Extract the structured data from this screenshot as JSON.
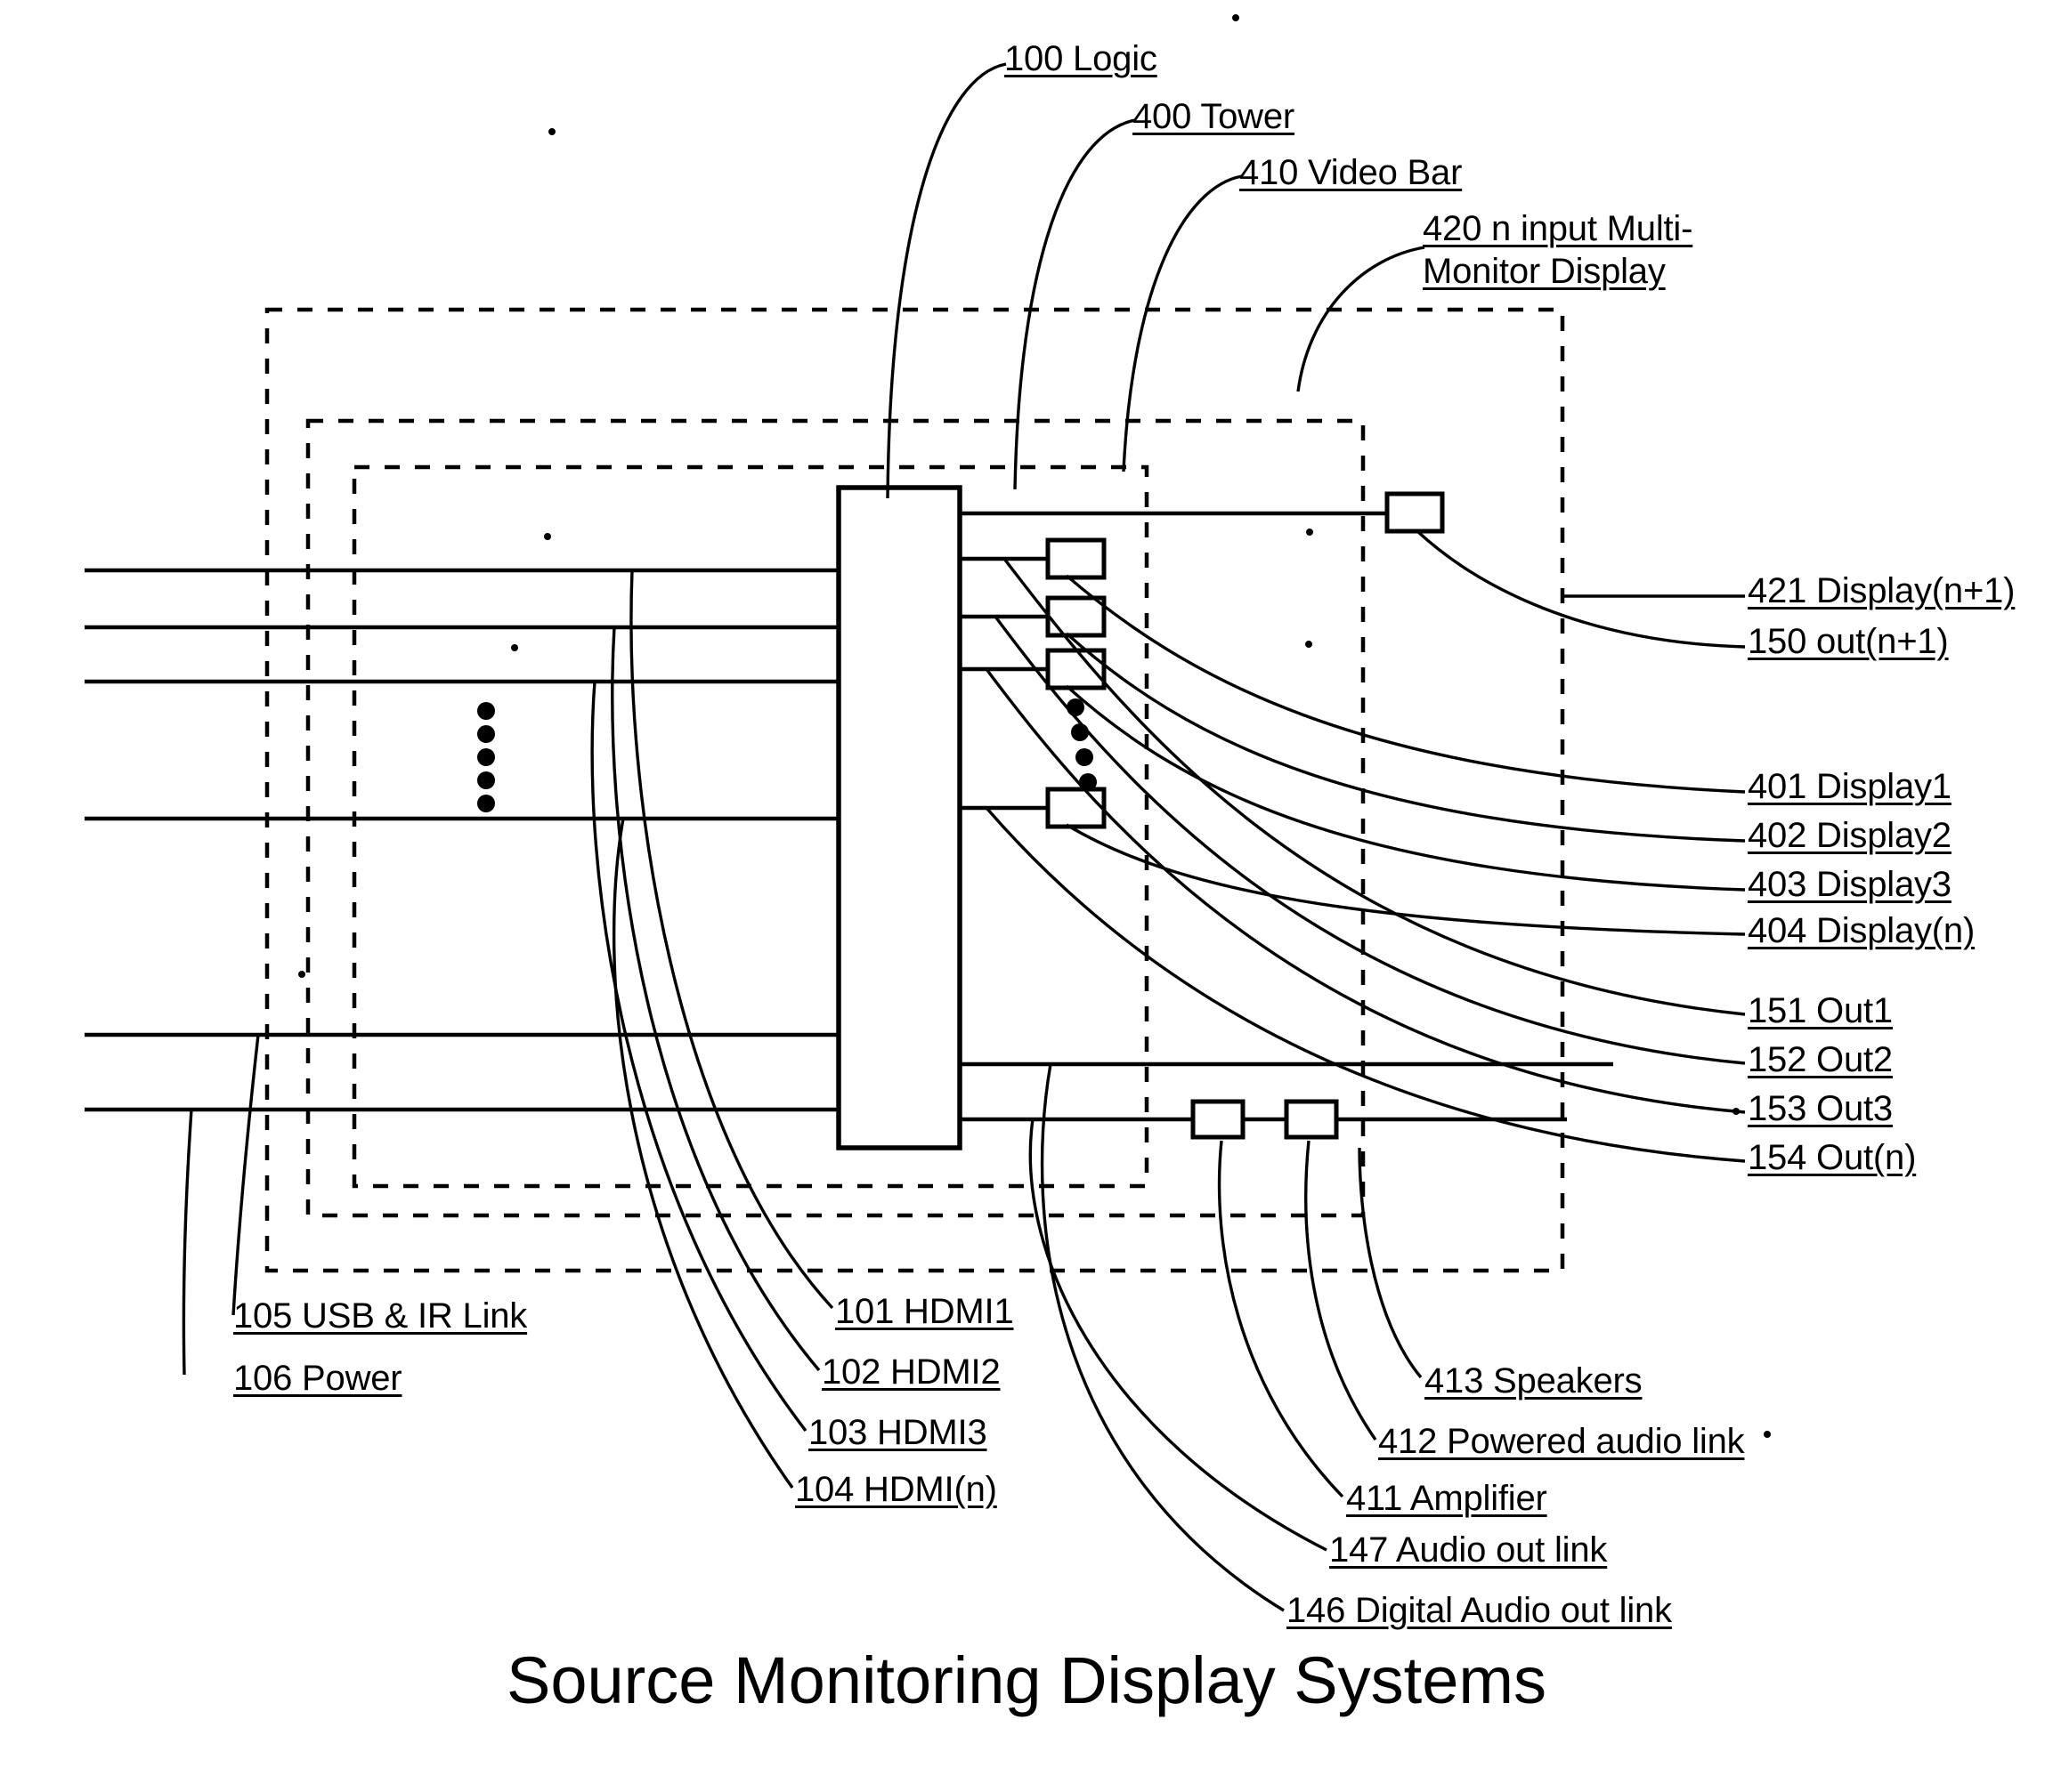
{
  "figure": {
    "title": "Source Monitoring Display Systems"
  },
  "blocks": {
    "logic": {
      "ref": "100",
      "name": "Logic",
      "label": "100 Logic"
    },
    "tower": {
      "ref": "400",
      "name": "Tower",
      "label": "400 Tower"
    },
    "video_bar": {
      "ref": "410",
      "name": "Video Bar",
      "label": "410 Video Bar"
    },
    "multi_monitor": {
      "ref": "420",
      "name": "n input Multi-Monitor Display",
      "label_line1": "420 n input Multi-",
      "label_line2": "Monitor Display"
    }
  },
  "callouts_top": [
    {
      "id": "callout-100-logic",
      "label": "100 Logic"
    },
    {
      "id": "callout-400-tower",
      "label": "400 Tower"
    },
    {
      "id": "callout-410-video-bar",
      "label": "410 Video Bar"
    },
    {
      "id": "callout-420-multi-monitor",
      "label_line1": "420 n input Multi-",
      "label_line2": "Monitor Display"
    }
  ],
  "callouts_right": [
    {
      "id": "callout-421",
      "label": "421 Display(n+1)"
    },
    {
      "id": "callout-150",
      "label": "150 out(n+1)"
    },
    {
      "id": "callout-401",
      "label": "401 Display1"
    },
    {
      "id": "callout-402",
      "label": "402 Display2"
    },
    {
      "id": "callout-403",
      "label": "403 Display3"
    },
    {
      "id": "callout-404",
      "label": "404 Display(n)"
    },
    {
      "id": "callout-151",
      "label": "151 Out1"
    },
    {
      "id": "callout-152",
      "label": "152 Out2"
    },
    {
      "id": "callout-153",
      "label": "153 Out3"
    },
    {
      "id": "callout-154",
      "label": "154 Out(n)"
    }
  ],
  "callouts_bottom_left": [
    {
      "id": "callout-105",
      "label": "105 USB & IR Link"
    },
    {
      "id": "callout-106",
      "label": "106 Power"
    }
  ],
  "callouts_bottom_hdmi": [
    {
      "id": "callout-101",
      "label": "101 HDMI1"
    },
    {
      "id": "callout-102",
      "label": "102 HDMI2"
    },
    {
      "id": "callout-103",
      "label": "103 HDMI3"
    },
    {
      "id": "callout-104",
      "label": "104 HDMI(n)"
    }
  ],
  "callouts_bottom_audio": [
    {
      "id": "callout-413",
      "label": "413 Speakers"
    },
    {
      "id": "callout-412",
      "label": "412 Powered audio link"
    },
    {
      "id": "callout-411",
      "label": "411 Amplifier"
    },
    {
      "id": "callout-147",
      "label": "147 Audio out link"
    },
    {
      "id": "callout-146",
      "label": "146 Digital Audio out link"
    }
  ],
  "colors": {
    "ink": "#000000",
    "paper": "#ffffff"
  }
}
